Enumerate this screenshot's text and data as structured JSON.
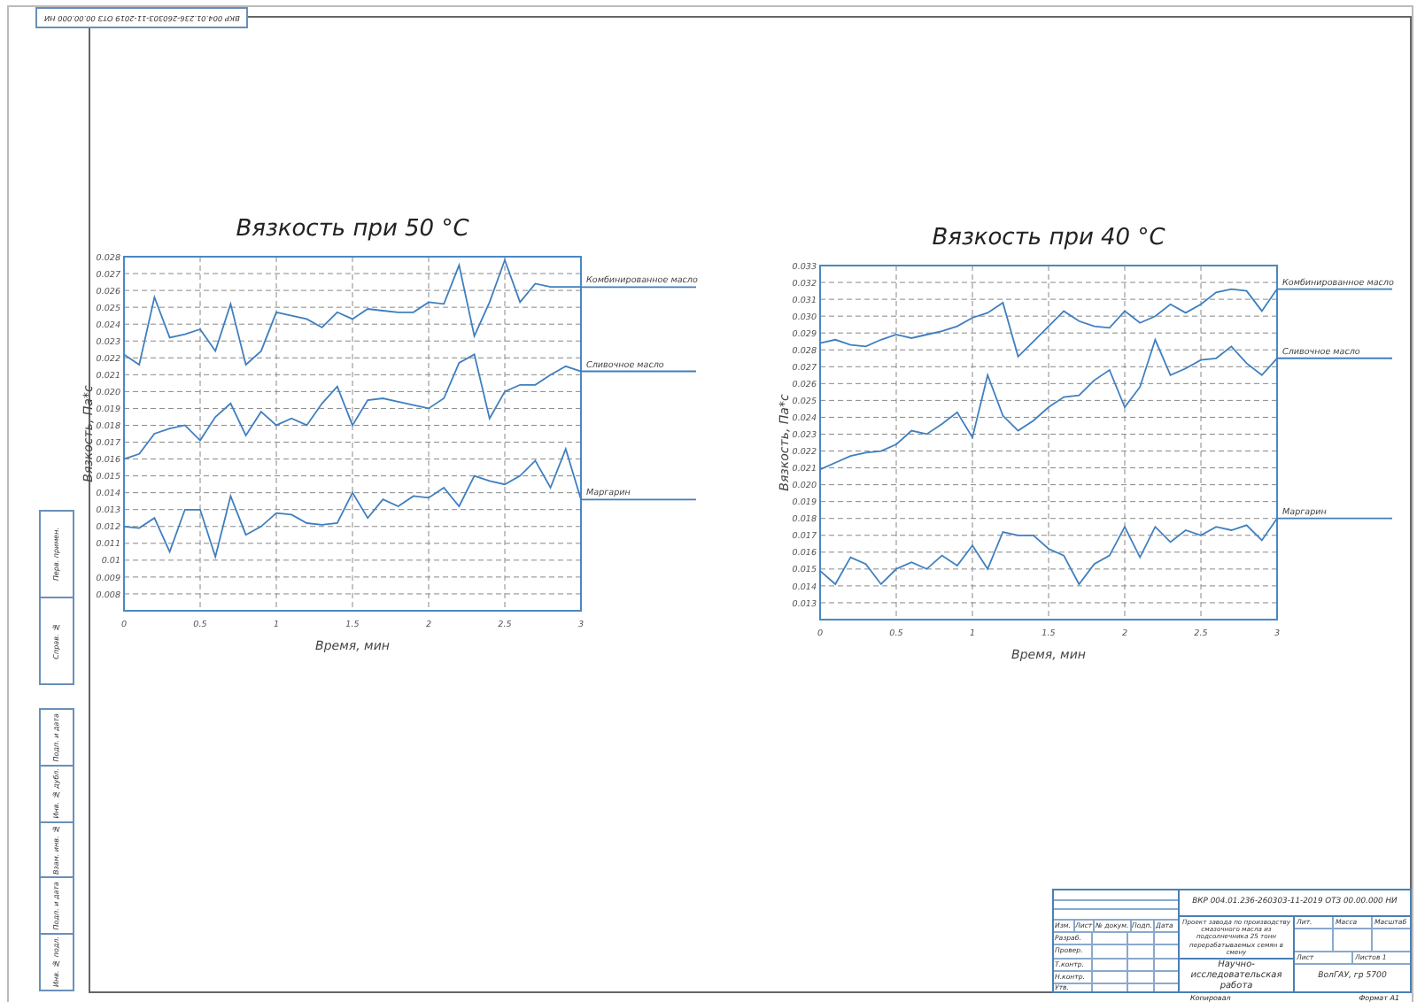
{
  "corner_stamp": "ВКР 004.01.236-260303-11-2019 ОТЗ 00.00.000 НИ",
  "side_stamp": {
    "upper": [
      "Перв. примен.",
      "Справ. №"
    ],
    "lower": [
      "Подп. и дата",
      "Инв. № дубл.",
      "Взам. инв. №",
      "Подп. и дата",
      "Инв. № подл."
    ]
  },
  "charts": [
    {
      "chart_data": {
        "type": "line",
        "grid": true,
        "title": "Вязкость при 50 °С",
        "xlabel": "Время, мин",
        "ylabel": "Вязкость, Па*с",
        "x": [
          0,
          0.1,
          0.2,
          0.3,
          0.4,
          0.5,
          0.6,
          0.7,
          0.8,
          0.9,
          1,
          1.1,
          1.2,
          1.3,
          1.4,
          1.5,
          1.6,
          1.7,
          1.8,
          1.9,
          2,
          2.1,
          2.2,
          2.3,
          2.4,
          2.5,
          2.6,
          2.7,
          2.8,
          2.9,
          3
        ],
        "series": [
          {
            "name": "Комбинированное масло",
            "color": "#3f7fbf",
            "values": [
              0.0222,
              0.0216,
              0.0256,
              0.0232,
              0.0234,
              0.0237,
              0.0224,
              0.0252,
              0.0216,
              0.0224,
              0.0247,
              0.0245,
              0.0243,
              0.0238,
              0.0247,
              0.0243,
              0.0249,
              0.0248,
              0.0247,
              0.0247,
              0.0253,
              0.0252,
              0.0275,
              0.0233,
              0.0253,
              0.0278,
              0.0253,
              0.0264,
              0.0262,
              0.0262,
              0.0262
            ]
          },
          {
            "name": "Сливочное масло",
            "color": "#3f7fbf",
            "values": [
              0.016,
              0.0163,
              0.0175,
              0.0178,
              0.018,
              0.0171,
              0.0185,
              0.0193,
              0.0174,
              0.0188,
              0.018,
              0.0184,
              0.018,
              0.0193,
              0.0203,
              0.018,
              0.0195,
              0.0196,
              0.0194,
              0.0192,
              0.019,
              0.0196,
              0.0217,
              0.0222,
              0.0184,
              0.02,
              0.0204,
              0.0204,
              0.021,
              0.0215,
              0.0212
            ]
          },
          {
            "name": "Маргарин",
            "color": "#3f7fbf",
            "values": [
              0.012,
              0.0119,
              0.0125,
              0.0105,
              0.013,
              0.013,
              0.0102,
              0.0138,
              0.0115,
              0.012,
              0.0128,
              0.0127,
              0.0122,
              0.0121,
              0.0122,
              0.014,
              0.0125,
              0.0136,
              0.0132,
              0.0138,
              0.0137,
              0.0143,
              0.0132,
              0.015,
              0.0147,
              0.0145,
              0.015,
              0.0159,
              0.0143,
              0.0166,
              0.0136
            ]
          }
        ],
        "xlim": [
          0,
          3
        ],
        "ylim": [
          0.007,
          0.028
        ],
        "xticks": [
          {
            "value": 0,
            "label": "0"
          },
          {
            "value": 0.5,
            "label": "0.5"
          },
          {
            "value": 1,
            "label": "1"
          },
          {
            "value": 1.5,
            "label": "1.5"
          },
          {
            "value": 2,
            "label": "2"
          },
          {
            "value": 2.5,
            "label": "2.5"
          },
          {
            "value": 3,
            "label": "3"
          }
        ],
        "yticks": [
          {
            "value": 0.008,
            "label": "0.008"
          },
          {
            "value": 0.009,
            "label": "0.009"
          },
          {
            "value": 0.01,
            "label": "0.01"
          },
          {
            "value": 0.011,
            "label": "0.011"
          },
          {
            "value": 0.012,
            "label": "0.012"
          },
          {
            "value": 0.013,
            "label": "0.013"
          },
          {
            "value": 0.014,
            "label": "0.014"
          },
          {
            "value": 0.015,
            "label": "0.015"
          },
          {
            "value": 0.016,
            "label": "0.016"
          },
          {
            "value": 0.017,
            "label": "0.017"
          },
          {
            "value": 0.018,
            "label": "0.018"
          },
          {
            "value": 0.019,
            "label": "0.019"
          },
          {
            "value": 0.02,
            "label": "0.020"
          },
          {
            "value": 0.021,
            "label": "0.021"
          },
          {
            "value": 0.022,
            "label": "0.022"
          },
          {
            "value": 0.023,
            "label": "0.023"
          },
          {
            "value": 0.024,
            "label": "0.024"
          },
          {
            "value": 0.025,
            "label": "0.025"
          },
          {
            "value": 0.026,
            "label": "0.026"
          },
          {
            "value": 0.027,
            "label": "0.027"
          },
          {
            "value": 0.028,
            "label": "0.028"
          }
        ]
      }
    },
    {
      "chart_data": {
        "type": "line",
        "grid": true,
        "title": "Вязкость при 40 °С",
        "xlabel": "Время, мин",
        "ylabel": "Вязкость, Па*с",
        "x": [
          0,
          0.1,
          0.2,
          0.3,
          0.4,
          0.5,
          0.6,
          0.7,
          0.8,
          0.9,
          1,
          1.1,
          1.2,
          1.3,
          1.4,
          1.5,
          1.6,
          1.7,
          1.8,
          1.9,
          2,
          2.1,
          2.2,
          2.3,
          2.4,
          2.5,
          2.6,
          2.7,
          2.8,
          2.9,
          3
        ],
        "series": [
          {
            "name": "Комбинированное масло",
            "color": "#3f7fbf",
            "values": [
              0.0284,
              0.0286,
              0.0283,
              0.0282,
              0.0286,
              0.0289,
              0.0287,
              0.0289,
              0.0291,
              0.0294,
              0.0299,
              0.0302,
              0.0308,
              0.0276,
              0.0285,
              0.0294,
              0.0303,
              0.0297,
              0.0294,
              0.0293,
              0.0303,
              0.0296,
              0.03,
              0.0307,
              0.0302,
              0.0307,
              0.0314,
              0.0316,
              0.0315,
              0.0303,
              0.0316
            ]
          },
          {
            "name": "Сливочное масло",
            "color": "#3f7fbf",
            "values": [
              0.0209,
              0.0213,
              0.0217,
              0.0219,
              0.022,
              0.0224,
              0.0232,
              0.023,
              0.0236,
              0.0243,
              0.0228,
              0.0265,
              0.0241,
              0.0232,
              0.0238,
              0.0246,
              0.0252,
              0.0253,
              0.0262,
              0.0268,
              0.0246,
              0.0258,
              0.0286,
              0.0265,
              0.0269,
              0.0274,
              0.0275,
              0.0282,
              0.0272,
              0.0265,
              0.0275
            ]
          },
          {
            "name": "Маргарин",
            "color": "#3f7fbf",
            "values": [
              0.0149,
              0.0141,
              0.0157,
              0.0153,
              0.0141,
              0.015,
              0.0154,
              0.015,
              0.0158,
              0.0152,
              0.0164,
              0.015,
              0.0172,
              0.017,
              0.017,
              0.0162,
              0.0158,
              0.0141,
              0.0153,
              0.0158,
              0.0175,
              0.0157,
              0.0175,
              0.0166,
              0.0173,
              0.017,
              0.0175,
              0.0173,
              0.0176,
              0.0167,
              0.018
            ]
          }
        ],
        "xlim": [
          0,
          3
        ],
        "ylim": [
          0.012,
          0.033
        ],
        "xticks": [
          {
            "value": 0,
            "label": "0"
          },
          {
            "value": 0.5,
            "label": "0.5"
          },
          {
            "value": 1,
            "label": "1"
          },
          {
            "value": 1.5,
            "label": "1.5"
          },
          {
            "value": 2,
            "label": "2"
          },
          {
            "value": 2.5,
            "label": "2.5"
          },
          {
            "value": 3,
            "label": "3"
          }
        ],
        "yticks": [
          {
            "value": 0.013,
            "label": "0.013"
          },
          {
            "value": 0.014,
            "label": "0.014"
          },
          {
            "value": 0.015,
            "label": "0.015"
          },
          {
            "value": 0.016,
            "label": "0.016"
          },
          {
            "value": 0.017,
            "label": "0.017"
          },
          {
            "value": 0.018,
            "label": "0.018"
          },
          {
            "value": 0.019,
            "label": "0.019"
          },
          {
            "value": 0.02,
            "label": "0.020"
          },
          {
            "value": 0.021,
            "label": "0.021"
          },
          {
            "value": 0.022,
            "label": "0.022"
          },
          {
            "value": 0.023,
            "label": "0.023"
          },
          {
            "value": 0.024,
            "label": "0.024"
          },
          {
            "value": 0.025,
            "label": "0.025"
          },
          {
            "value": 0.026,
            "label": "0.026"
          },
          {
            "value": 0.027,
            "label": "0.027"
          },
          {
            "value": 0.028,
            "label": "0.028"
          },
          {
            "value": 0.029,
            "label": "0.029"
          },
          {
            "value": 0.03,
            "label": "0.030"
          },
          {
            "value": 0.031,
            "label": "0.031"
          },
          {
            "value": 0.032,
            "label": "0.032"
          },
          {
            "value": 0.033,
            "label": "0.033"
          }
        ]
      }
    }
  ],
  "title_block": {
    "designation": "ВКР 004.01.236-260303-11-2019 ОТЗ 00.00.000 НИ",
    "header": [
      "Изм.",
      "Лист",
      "№ докум.",
      "Подп.",
      "Дата"
    ],
    "roles": [
      "Разраб.",
      "Провер.",
      "Т.контр.",
      "Н.контр.",
      "Утв."
    ],
    "description": "Проект завода по производству смазочного масла из подсолнечника 25 тонн перерабатываемых семян в смену",
    "work_type": "Научно-исследовательская работа",
    "sheet_headers": [
      "Лит.",
      "Масса",
      "Масштаб"
    ],
    "sheet_count": [
      "Лист",
      "Листов 1"
    ],
    "organization": "ВолГАУ, гр 5700",
    "footer": [
      "Копировал",
      "Формат А1"
    ]
  }
}
